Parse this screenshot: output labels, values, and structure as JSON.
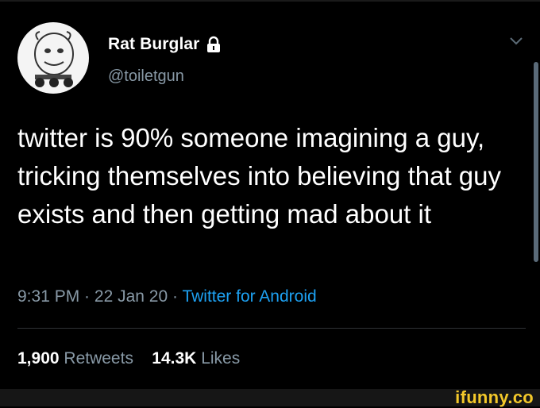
{
  "tweet": {
    "author": {
      "display_name": "Rat Burglar",
      "handle": "@toiletgun",
      "protected_icon": "lock-icon",
      "avatar": "avatar"
    },
    "text": "twitter is 90% someone imagining a guy, tricking themselves into believing that guy exists and then getting mad about it",
    "time": "9:31 PM",
    "date": "22 Jan 20",
    "source": "Twitter for Android",
    "separator": " · ",
    "stats": {
      "retweets_count": "1,900",
      "retweets_label": "Retweets",
      "likes_count": "14.3K",
      "likes_label": "Likes"
    },
    "menu_icon": "chevron-down-icon"
  },
  "watermark": {
    "text": "ifunny.co"
  },
  "colors": {
    "background": "#000000",
    "secondary_text": "#8899a6",
    "link": "#1da1f2",
    "watermark": "#f3c82a"
  }
}
